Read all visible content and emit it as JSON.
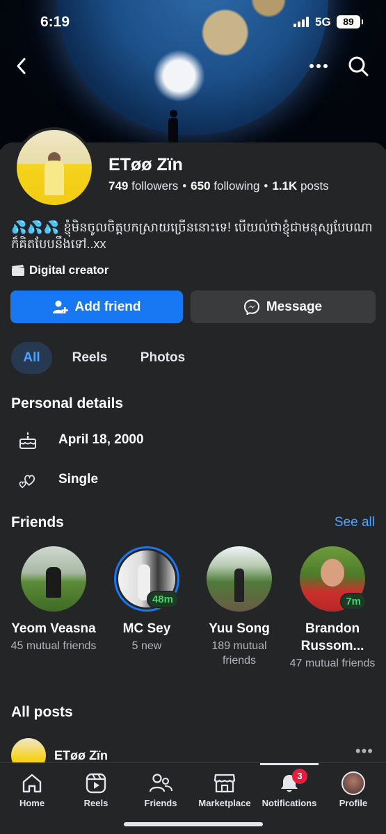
{
  "status_bar": {
    "time": "6:19",
    "network": "5G",
    "battery": "89"
  },
  "profile": {
    "name": "ETøø Zïn",
    "followers_count": "749",
    "followers_label": "followers",
    "following_count": "650",
    "following_label": "following",
    "posts_count": "1.1K",
    "posts_label": "posts",
    "bio_emoji": "💦💦💦",
    "bio": "ខ្ញុំមិនចូលចិត្តបកស្រាយច្រើននោះទេ! បើយល់ថាខ្ញុំជាមនុស្សបែបណា ក៏គិតបែបនឹងទៅ..xx",
    "category": "Digital creator"
  },
  "actions": {
    "add_friend": "Add friend",
    "message": "Message"
  },
  "tabs": [
    {
      "label": "All",
      "active": true
    },
    {
      "label": "Reels"
    },
    {
      "label": "Photos"
    }
  ],
  "personal_details": {
    "title": "Personal details",
    "birthday": "April 18, 2000",
    "relationship": "Single"
  },
  "friends": {
    "title": "Friends",
    "see_all": "See all",
    "items": [
      {
        "name": "Yeom Veasna",
        "sub": "45 mutual friends"
      },
      {
        "name": "MC Sey",
        "sub": "5 new",
        "badge": "48m"
      },
      {
        "name": "Yuu Song",
        "sub": "189 mutual friends"
      },
      {
        "name": "Brandon Russom...",
        "sub": "47 mutual friends",
        "badge": "7m"
      }
    ]
  },
  "posts": {
    "title": "All posts",
    "author": "ETøø Zïn"
  },
  "bottom_nav": {
    "home": "Home",
    "reels": "Reels",
    "friends": "Friends",
    "marketplace": "Marketplace",
    "notifications": "Notifications",
    "notifications_badge": "3",
    "profile": "Profile"
  },
  "colors": {
    "accent": "#1877f2",
    "link": "#4da3ff",
    "background": "#242526",
    "badge_red": "#e41e3f",
    "online_green": "#45d36e"
  }
}
